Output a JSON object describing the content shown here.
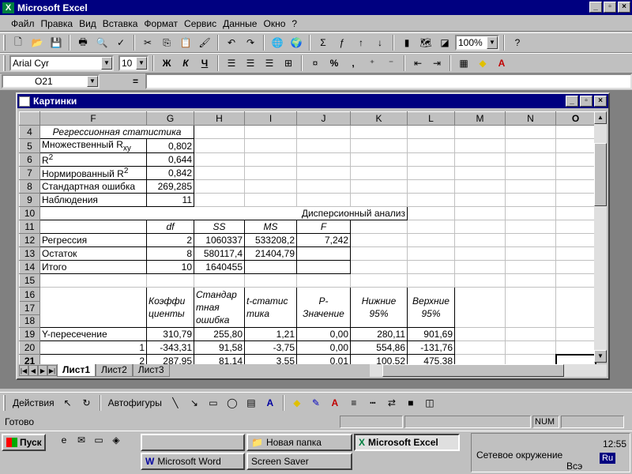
{
  "app": {
    "title": "Microsoft Excel",
    "minimize": "_",
    "maximize": "▫",
    "close": "×"
  },
  "menu": [
    "Файл",
    "Правка",
    "Вид",
    "Вставка",
    "Формат",
    "Сервис",
    "Данные",
    "Окно",
    "?"
  ],
  "standard_toolbar": {
    "zoom": "100%"
  },
  "format_toolbar": {
    "font": "Arial Cyr",
    "size": "10",
    "bold": "Ж",
    "italic": "К",
    "underline": "Ч",
    "percent": "%",
    "comma": ","
  },
  "formula_bar": {
    "cell_ref": "O21",
    "eq": "=",
    "value": ""
  },
  "window": {
    "title": "Картинки"
  },
  "columns": [
    "F",
    "G",
    "H",
    "I",
    "J",
    "K",
    "L",
    "M",
    "N",
    "O"
  ],
  "cells": {
    "r4": [
      "Регрессионная статистика"
    ],
    "r5": [
      "Множественный R",
      "0,802"
    ],
    "r5_sub": "xy",
    "r6": [
      "R",
      "0,644"
    ],
    "r6_sup": "2",
    "r7": [
      "Нормированный R",
      "0,842"
    ],
    "r7_sup": "2",
    "r8": [
      "Стандартная ошибка",
      "269,285"
    ],
    "r9": [
      "Наблюдения",
      "11"
    ],
    "r10": [
      "Дисперсионный анализ"
    ],
    "r11": [
      "df",
      "SS",
      "MS",
      "F"
    ],
    "r12": [
      "Регрессия",
      "2",
      "1060337",
      "533208,2",
      "7,242"
    ],
    "r13": [
      "Остаток",
      "8",
      "580117,4",
      "21404,79"
    ],
    "r14": [
      "Итого",
      "10",
      "1640455"
    ],
    "r16_header": [
      "Коэффи циенты",
      "Стандар тная ошибка",
      "t-статис тика",
      "P-Значение",
      "Нижние 95%",
      "Верхние 95%"
    ],
    "r19": [
      "Y-пересечение",
      "310,79",
      "255,80",
      "1,21",
      "0,00",
      "280,11",
      "901,69"
    ],
    "r20": [
      "1",
      "-343,31",
      "91,58",
      "-3,75",
      "0,00",
      "554,86",
      "-131,76"
    ],
    "r21": [
      "2",
      "287,95",
      "81,14",
      "3,55",
      "0,01",
      "100,52",
      "475,38"
    ]
  },
  "rows": [
    "4",
    "5",
    "6",
    "7",
    "8",
    "9",
    "10",
    "11",
    "12",
    "13",
    "14",
    "15",
    "16",
    "17",
    "18",
    "19",
    "20",
    "21"
  ],
  "tabs": [
    "Лист1",
    "Лист2",
    "Лист3"
  ],
  "drawing_toolbar": {
    "actions": "Действия",
    "autoshapes": "Автофигуры"
  },
  "status": {
    "ready": "Готово",
    "num": "NUM"
  },
  "taskbar": {
    "start": "Пуск",
    "tasks": [
      "Новая папка",
      "Microsoft Excel",
      "Microsoft Word",
      "Screen Saver"
    ],
    "network": "Сетевое окружение",
    "vs": "Всэ",
    "time": "12:55",
    "lang": "Ru"
  }
}
